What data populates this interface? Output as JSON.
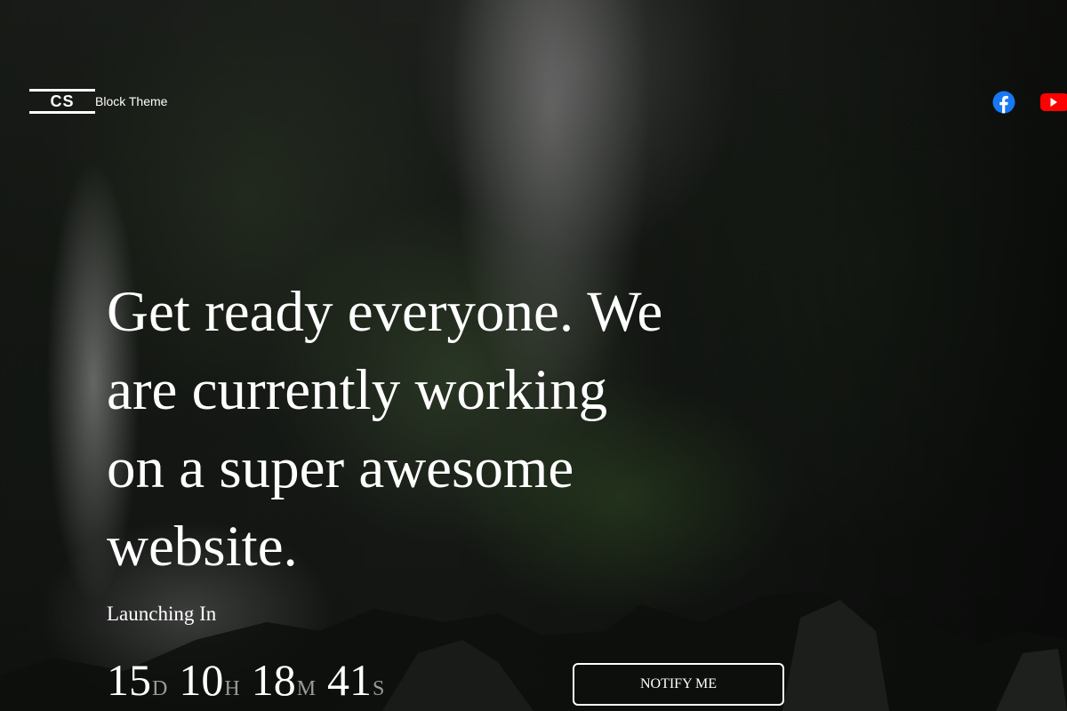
{
  "header": {
    "logo_mark": "CS",
    "site_name": "Block Theme"
  },
  "social": [
    {
      "name": "facebook-icon",
      "color": "#1877F2"
    },
    {
      "name": "youtube-icon",
      "color": "#FF0000"
    }
  ],
  "hero": {
    "headline": "Get ready everyone. We are currently working on a super awesome website.",
    "launch_label": "Launching In"
  },
  "countdown": {
    "days": "15",
    "days_label": "D",
    "hours": "10",
    "hours_label": "H",
    "minutes": "18",
    "minutes_label": "M",
    "seconds": "41",
    "seconds_label": "S"
  },
  "notify_button": {
    "label": "NOTIFY ME"
  },
  "colors": {
    "text": "#FFFFFF",
    "countdown_label": "#9A9A9A",
    "facebook": "#1877F2",
    "youtube": "#FF0000"
  }
}
